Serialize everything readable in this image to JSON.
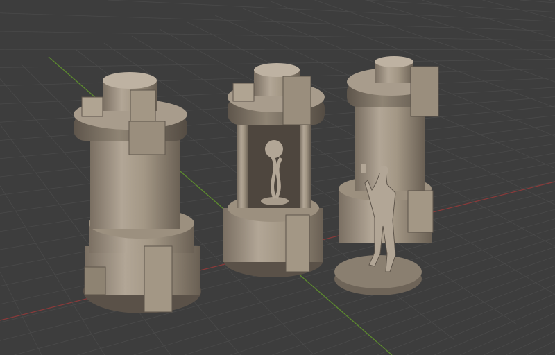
{
  "viewport": {
    "background_color": "#3d3d3d",
    "grid_color": "#4a4a4a",
    "x_axis_color": "#8a3a3a",
    "y_axis_color": "#5c8a2e",
    "model_color": "#a89c8c",
    "model_shadow_color": "#6e6458",
    "model_highlight_color": "#c4b8a8"
  },
  "objects": [
    {
      "name": "capsule-tank-1"
    },
    {
      "name": "capsule-tank-2-with-plant"
    },
    {
      "name": "capsule-tank-3"
    },
    {
      "name": "character-miniature"
    }
  ]
}
